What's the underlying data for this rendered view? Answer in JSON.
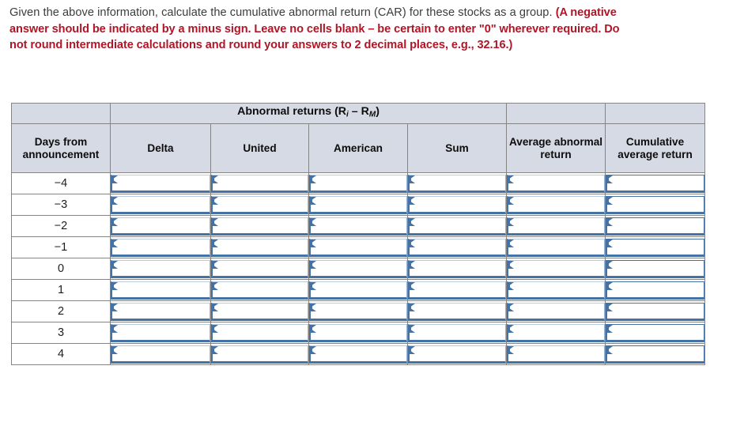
{
  "prompt": {
    "line1_plain": "Given the above information, calculate the cumulative abnormal return (CAR) for these",
    "line2_plain": "stocks as a group. ",
    "note": "(A negative answer should be indicated by a minus sign. Leave no cells blank – be certain to enter \"0\" wherever required. Do not round intermediate calculations and round your answers to 2 decimal places, e.g., 32.16.)"
  },
  "table": {
    "group_header": {
      "label_prefix": "Abnormal returns (R",
      "sub_i": "i",
      "label_dash": " – R",
      "sub_m": "M",
      "label_suffix": ")"
    },
    "columns": [
      {
        "id": "days",
        "label": "Days from announcement"
      },
      {
        "id": "delta",
        "label": "Delta"
      },
      {
        "id": "united",
        "label": "United"
      },
      {
        "id": "american",
        "label": "American"
      },
      {
        "id": "sum",
        "label": "Sum"
      },
      {
        "id": "avg_abnormal",
        "label": "Average abnormal return"
      },
      {
        "id": "cumulative_avg",
        "label": "Cumulative average return"
      }
    ],
    "rows": [
      {
        "day": "−4",
        "delta": "",
        "united": "",
        "american": "",
        "sum": "",
        "avg_abnormal": "",
        "cumulative_avg": ""
      },
      {
        "day": "−3",
        "delta": "",
        "united": "",
        "american": "",
        "sum": "",
        "avg_abnormal": "",
        "cumulative_avg": ""
      },
      {
        "day": "−2",
        "delta": "",
        "united": "",
        "american": "",
        "sum": "",
        "avg_abnormal": "",
        "cumulative_avg": ""
      },
      {
        "day": "−1",
        "delta": "",
        "united": "",
        "american": "",
        "sum": "",
        "avg_abnormal": "",
        "cumulative_avg": ""
      },
      {
        "day": "0",
        "delta": "",
        "united": "",
        "american": "",
        "sum": "",
        "avg_abnormal": "",
        "cumulative_avg": ""
      },
      {
        "day": "1",
        "delta": "",
        "united": "",
        "american": "",
        "sum": "",
        "avg_abnormal": "",
        "cumulative_avg": ""
      },
      {
        "day": "2",
        "delta": "",
        "united": "",
        "american": "",
        "sum": "",
        "avg_abnormal": "",
        "cumulative_avg": ""
      },
      {
        "day": "3",
        "delta": "",
        "united": "",
        "american": "",
        "sum": "",
        "avg_abnormal": "",
        "cumulative_avg": ""
      },
      {
        "day": "4",
        "delta": "",
        "united": "",
        "american": "",
        "sum": "",
        "avg_abnormal": "",
        "cumulative_avg": ""
      }
    ]
  },
  "colors": {
    "header_fill": "#d6dae4",
    "grid_border": "#858585",
    "input_blue": "#4472a4",
    "note_red": "#b01627",
    "body_text": "#3c3c3c"
  }
}
